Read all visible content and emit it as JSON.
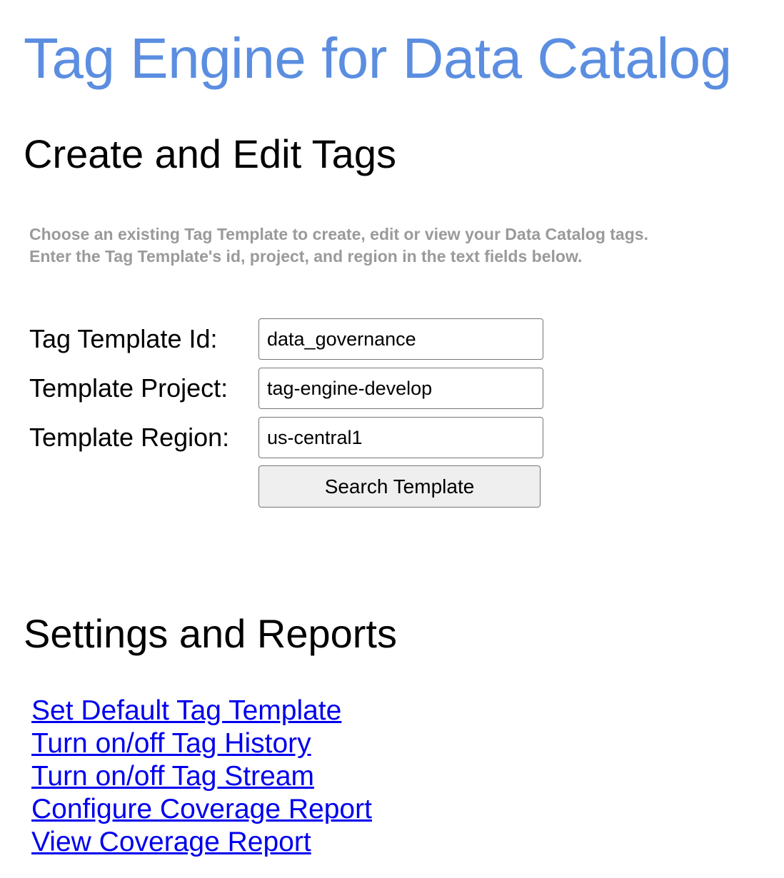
{
  "header": {
    "app_title": "Tag Engine for Data Catalog"
  },
  "create_section": {
    "title": "Create and Edit Tags",
    "instructions": [
      "Choose an existing Tag Template to create, edit or view your Data Catalog tags.",
      "Enter the Tag Template's id, project, and region in the text fields below."
    ],
    "fields": {
      "template_id": {
        "label": "Tag Template Id:",
        "value": "data_governance"
      },
      "template_project": {
        "label": "Template Project:",
        "value": "tag-engine-develop"
      },
      "template_region": {
        "label": "Template Region:",
        "value": "us-central1"
      }
    },
    "search_button_label": "Search Template"
  },
  "settings_section": {
    "title": "Settings and Reports",
    "links": [
      {
        "label": "Set Default Tag Template"
      },
      {
        "label": "Turn on/off Tag History"
      },
      {
        "label": "Turn on/off Tag Stream"
      },
      {
        "label": "Configure Coverage Report"
      },
      {
        "label": "View Coverage Report"
      }
    ]
  },
  "colors": {
    "title_blue": "#5b8ee0",
    "instruction_gray": "#9a9a9a",
    "link_blue": "#0000ee",
    "button_bg": "#efefef"
  }
}
